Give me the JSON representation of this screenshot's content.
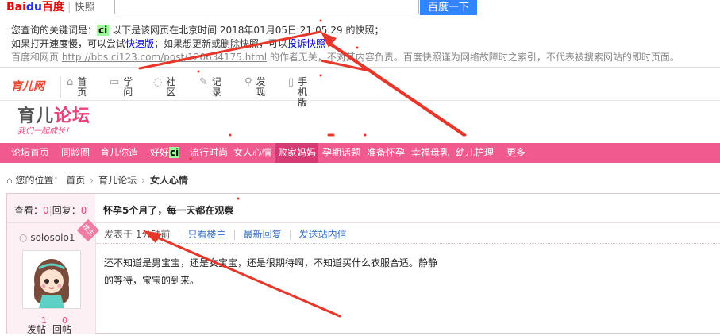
{
  "baidu_header": {
    "logo_bai": "Bai",
    "logo_du": "du",
    "logo_cn": "百度",
    "logo_product": "快照",
    "search_button": "百度一下",
    "search_value": ""
  },
  "snapshot_info": {
    "line1_prefix": "您查询的关键词是：",
    "keyword": "ci",
    "line1_suffix": "以下是该网页在北京时间 2018年01月05日 21:05:29 的快照；",
    "line2_prefix": "如果打开速度慢，可以尝试",
    "fast_link": "快速版",
    "line2_middle": "；如果想更新或删除快照，可以",
    "complaint_link": "投诉快照",
    "line3_prefix": "百度和网页",
    "source_url": "http://bbs.ci123.com/post/120634175.html",
    "line3_suffix": "的作者无关，不对其内容负责。百度快照谨为网络故障时之索引，不代表被搜索网站的即时页面。"
  },
  "site_nav": {
    "logo": "育儿网",
    "items": [
      {
        "label": "首页",
        "icon": "home-icon",
        "glyph": "⌂"
      },
      {
        "label": "学问",
        "icon": "book-icon",
        "glyph": "▭"
      },
      {
        "label": "社区",
        "icon": "chat-icon",
        "glyph": "◌"
      },
      {
        "label": "记录",
        "icon": "edit-icon",
        "glyph": "✎"
      },
      {
        "label": "发现",
        "icon": "search-icon",
        "glyph": "⚲"
      },
      {
        "label": "手机版",
        "icon": "phone-icon",
        "glyph": "▯"
      }
    ]
  },
  "forum": {
    "title_a": "育儿",
    "title_b": "论坛",
    "slogan": "我们一起成长！"
  },
  "channels": [
    {
      "label": "论坛首页",
      "active": false
    },
    {
      "label": "同龄圈",
      "active": false
    },
    {
      "label": "育儿你造",
      "active": false
    },
    {
      "label": "好好",
      "keyword": "ci",
      "active": false
    },
    {
      "label": "流行时尚",
      "active": false
    },
    {
      "label": "女人心情",
      "active": false
    },
    {
      "label": "败家妈妈",
      "active": true
    },
    {
      "label": "孕期话题",
      "active": false
    },
    {
      "label": "准备怀孕",
      "active": false
    },
    {
      "label": "幸福母乳",
      "active": false
    },
    {
      "label": "幼儿护理",
      "active": false
    },
    {
      "label": "更多-",
      "active": false
    }
  ],
  "breadcrumb": {
    "prefix": "您的位置：",
    "items": [
      "首页",
      "育儿论坛",
      "女人心情"
    ]
  },
  "thread": {
    "views_label": "查看：",
    "views": "0",
    "replies_label": "回复：",
    "replies": "0",
    "title": "怀孕5个月了，每一天都在观察"
  },
  "post": {
    "author": "solosolo1",
    "badge": "楼主",
    "post_count": "1",
    "reply_count": "0",
    "post_label": "发帖",
    "reply_label": "回帖",
    "posted_prefix": "发表于",
    "posted_time": "1分钟前",
    "only_author": "只看楼主",
    "latest_reply": "最新回复",
    "send_message": "发送站内信",
    "body": "还不知道是男宝宝，还是女宝宝，还是很期待啊，不知道买什么衣服合适。静静的等待，宝宝的到来。"
  },
  "colors": {
    "channel_bar": "#f05a8f",
    "keyword_highlight": "#9cff9c",
    "annotation_arrow": "#e8362a",
    "baidu_button": "#3385ff"
  }
}
